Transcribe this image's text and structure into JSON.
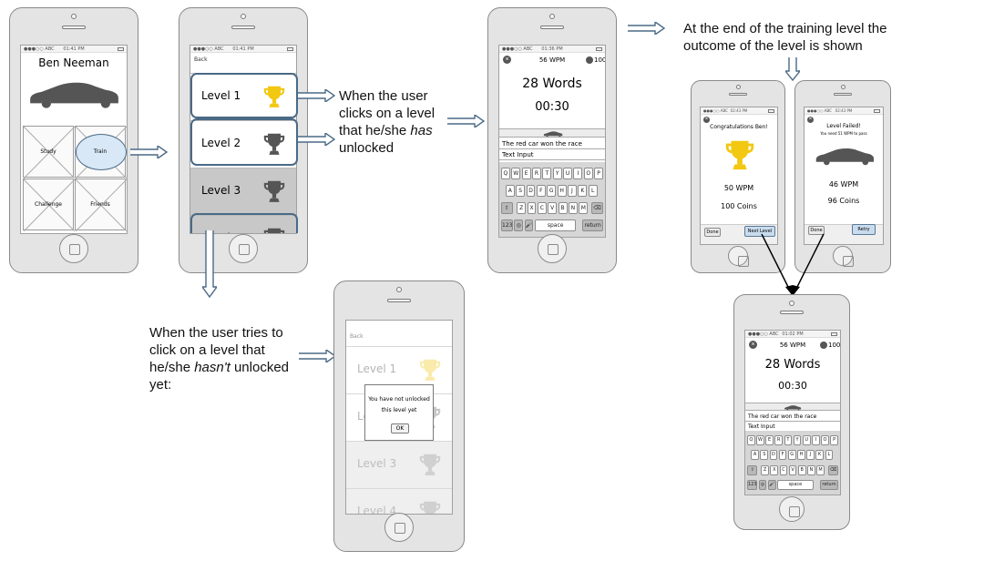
{
  "status_bar": {
    "carrier": "●●●○○ ABC",
    "time_home": "01:41 PM",
    "time_list": "01:41 PM",
    "time_typing": "01:36 PM",
    "time_result": "02:43 PM",
    "time_typing_again": "01:02 PM"
  },
  "home_screen": {
    "user_name": "Ben Neeman",
    "menu": {
      "study": "Study",
      "train": "Train",
      "challenge": "Challenge",
      "friends": "Friends"
    }
  },
  "level_list": {
    "back": "Back",
    "levels": [
      "Level 1",
      "Level 2",
      "Level 3",
      "Level 4"
    ]
  },
  "typing_screen": {
    "wpm": "56 WPM",
    "coins": "100",
    "words": "28 Words",
    "timer": "00:30",
    "sentence": "The red car won the race",
    "input_placeholder": "Text Input",
    "keys_row1": [
      "Q",
      "W",
      "E",
      "R",
      "T",
      "Y",
      "U",
      "I",
      "O",
      "P"
    ],
    "keys_row2": [
      "A",
      "S",
      "D",
      "F",
      "G",
      "H",
      "J",
      "K",
      "L"
    ],
    "keys_row3": [
      "Z",
      "X",
      "C",
      "V",
      "B",
      "N",
      "M"
    ],
    "key_123": "123",
    "key_space": "space",
    "key_return": "return"
  },
  "success_screen": {
    "title": "Congratulations Ben!",
    "wpm": "50 WPM",
    "coins": "100 Coins",
    "done": "Done",
    "next": "Next Level"
  },
  "fail_screen": {
    "title": "Level Failed!",
    "subtitle": "You need 51 WPM to pass",
    "wpm": "46 WPM",
    "coins": "96 Coins",
    "done": "Done",
    "retry": "Retry"
  },
  "locked_screen": {
    "back": "Back",
    "message_line1": "You have not unlocked",
    "message_line2": "this level yet",
    "ok": "OK"
  },
  "annotations": {
    "unlocked_1": "When the user",
    "unlocked_2": "clicks on a level",
    "unlocked_3": "that he/she",
    "unlocked_3_em": "has",
    "unlocked_4": "unlocked",
    "outcome_1": "At the end of the training level the",
    "outcome_2": "outcome of the level is shown",
    "locked_1": "When the user tries to",
    "locked_2": "click on a level that",
    "locked_3": "he/she",
    "locked_3_em": "hasn't",
    "locked_3_end": "unlocked",
    "locked_4": "yet:"
  },
  "colors": {
    "trophy_gold": "#f2c811",
    "trophy_dark": "#555555",
    "highlight": "#4a6a86",
    "locked_bg": "#c8c8c8"
  }
}
